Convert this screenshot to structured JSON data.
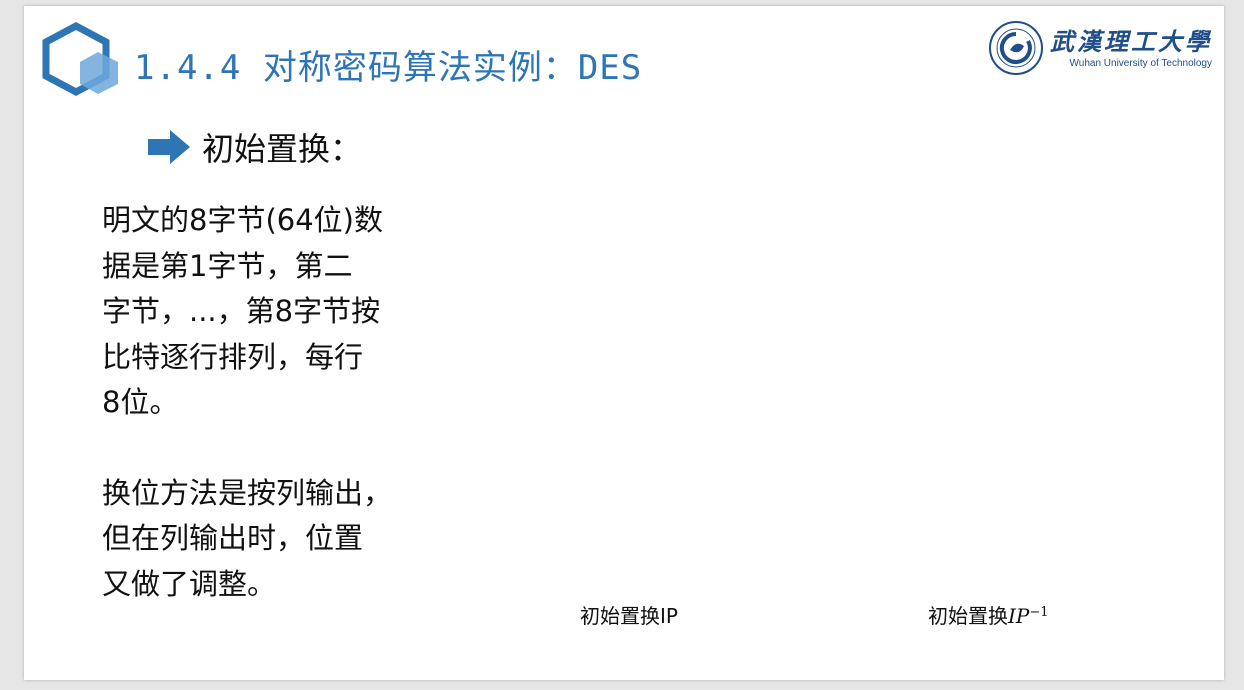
{
  "slide": {
    "title": "1.4.4 对称密码算法实例：DES",
    "university": {
      "name_cn": "武漢理工大學",
      "name_en": "Wuhan University of Technology"
    },
    "bullet": "初始置换：",
    "paragraphs": [
      "明文的8字节(64位)数\n据是第1字节，第二\n字节，...，第8字节按\n比特逐行排列，每行\n8位。",
      "换位方法是按列输出，\n但在列输出时，位置\n又做了调整。"
    ],
    "captions": {
      "ip": "初始置换IP",
      "ip_inverse_prefix": "初始置换",
      "ip_inverse_symbol": "IP",
      "ip_inverse_exponent": "−1"
    },
    "colors": {
      "accent": "#2e75b6",
      "hex_dark": "#2e75b6",
      "hex_light": "#6fa8dc",
      "logo": "#1f4e89"
    }
  }
}
